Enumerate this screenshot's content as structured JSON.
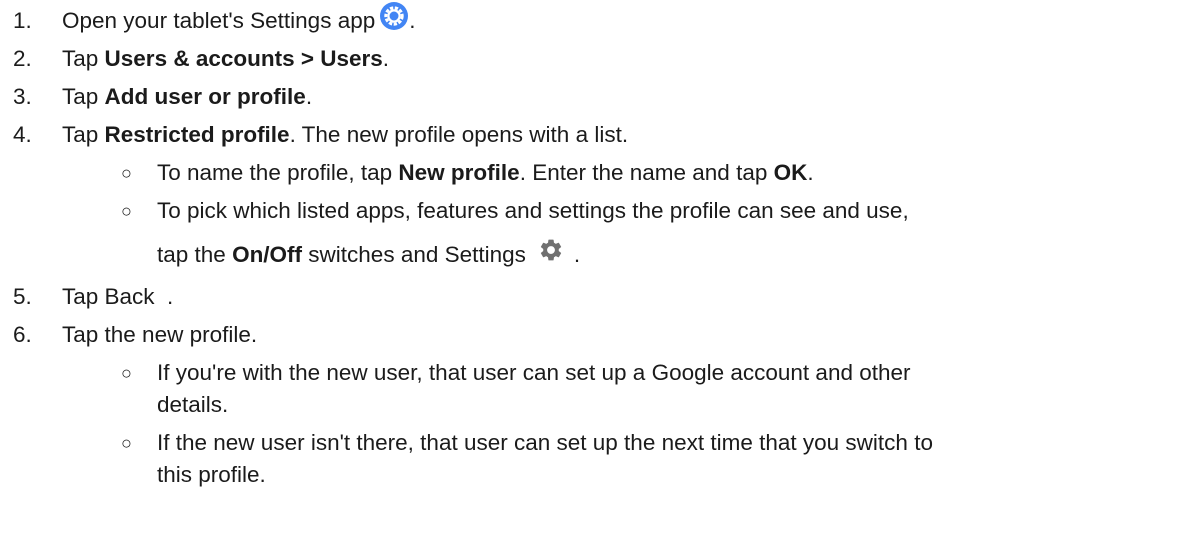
{
  "steps": [
    {
      "num": "1.",
      "pre": "Open your tablet's Settings app",
      "post": "."
    },
    {
      "num": "2.",
      "pre": "Tap ",
      "bold": "Users & accounts > Users",
      "post": "."
    },
    {
      "num": "3.",
      "pre": "Tap ",
      "bold": "Add user or profile",
      "post": "."
    },
    {
      "num": "4.",
      "pre": "Tap ",
      "bold": "Restricted profile",
      "post": ". The new profile opens with a list."
    },
    {
      "num": "5.",
      "pre": "Tap Back  ."
    },
    {
      "num": "6.",
      "pre": "Tap the new profile."
    }
  ],
  "substeps_4": [
    {
      "bullet": "○",
      "pre": "To name the profile, tap ",
      "bold1": "New profile",
      "mid": ". Enter the name and tap ",
      "bold2": "OK",
      "post": "."
    },
    {
      "bullet": "○",
      "line1": "To pick which listed apps, features and settings the profile can see and use,",
      "pre2": "tap the ",
      "bold": "On/Off",
      "mid": " switches and Settings",
      "post": "."
    }
  ],
  "substeps_6": [
    {
      "bullet": "○",
      "line1": "If you're with the new user, that user can set up a Google account and other",
      "line2": "details."
    },
    {
      "bullet": "○",
      "line1": "If the new user isn't there, that user can set up the next time that you switch to",
      "line2": "this profile."
    }
  ],
  "icons": {
    "settings_app": "settings-app-icon",
    "settings_gear": "gear-icon",
    "accent": "#4285f4"
  }
}
